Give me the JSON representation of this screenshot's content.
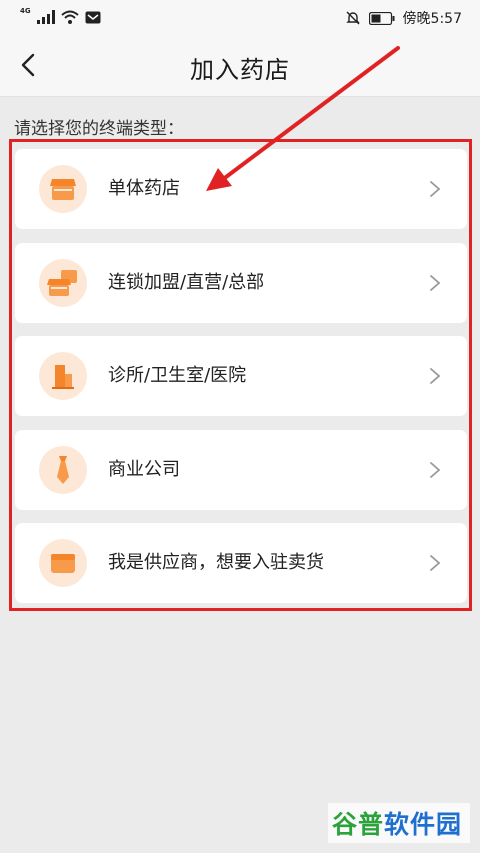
{
  "status_bar": {
    "network": "4G",
    "carrier_text": "傍晚",
    "time": "5:57"
  },
  "nav": {
    "title": "加入药店"
  },
  "section": {
    "label": "请选择您的终端类型："
  },
  "terminal_types": [
    {
      "label": "单体药店",
      "icon": "store-icon"
    },
    {
      "label": "连锁加盟/直营/总部",
      "icon": "chain-stores-icon"
    },
    {
      "label": "诊所/卫生室/医院",
      "icon": "building-icon"
    },
    {
      "label": "商业公司",
      "icon": "necktie-icon"
    },
    {
      "label": "我是供应商，想要入驻卖货",
      "icon": "supplier-box-icon"
    }
  ],
  "watermark": {
    "part1": "谷普",
    "part2": "软件园"
  },
  "colors": {
    "accent_orange": "#f5852a",
    "icon_bg": "#fde8d8",
    "annotation_red": "#e02222",
    "page_bg": "#ebebeb"
  }
}
